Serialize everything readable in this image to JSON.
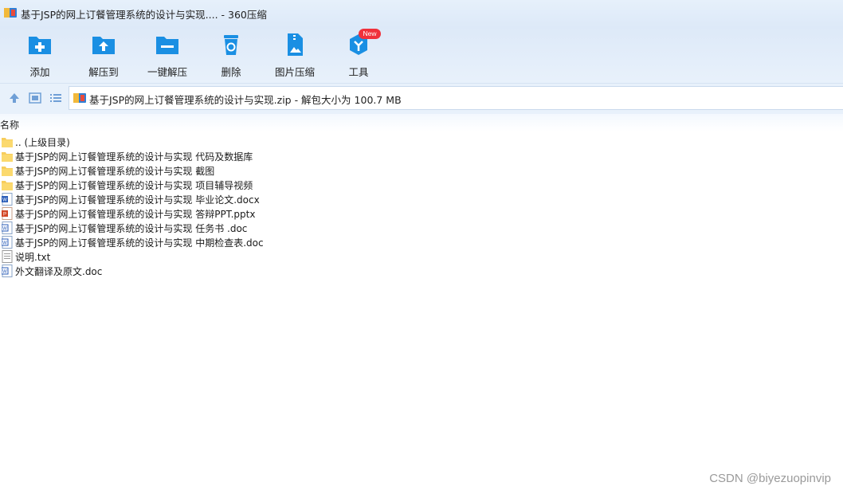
{
  "window": {
    "title": "基于JSP的网上订餐管理系统的设计与实现.... - 360压缩"
  },
  "toolbar": {
    "add_label": "添加",
    "extract_label": "解压到",
    "one_click_label": "一键解压",
    "delete_label": "删除",
    "image_compress_label": "图片压缩",
    "tools_label": "工具",
    "tools_badge": "New"
  },
  "address": {
    "path_text": "基于JSP的网上订餐管理系统的设计与实现.zip - 解包大小为 100.7 MB"
  },
  "list": {
    "column_name": "名称",
    "files": [
      {
        "name": ".. (上级目录)",
        "icon": "folder-icon"
      },
      {
        "name": "基于JSP的网上订餐管理系统的设计与实现 代码及数据库",
        "icon": "folder-icon"
      },
      {
        "name": "基于JSP的网上订餐管理系统的设计与实现 截图",
        "icon": "folder-icon"
      },
      {
        "name": "基于JSP的网上订餐管理系统的设计与实现 项目辅导视频",
        "icon": "folder-icon"
      },
      {
        "name": "基于JSP的网上订餐管理系统的设计与实现 毕业论文.docx",
        "icon": "word-docx-icon"
      },
      {
        "name": "基于JSP的网上订餐管理系统的设计与实现 答辩PPT.pptx",
        "icon": "powerpoint-icon"
      },
      {
        "name": "基于JSP的网上订餐管理系统的设计与实现 任务书 .doc",
        "icon": "word-doc-icon"
      },
      {
        "name": "基于JSP的网上订餐管理系统的设计与实现 中期检查表.doc",
        "icon": "word-doc-icon"
      },
      {
        "name": "说明.txt",
        "icon": "text-file-icon"
      },
      {
        "name": "外文翻译及原文.doc",
        "icon": "word-doc-icon"
      }
    ]
  },
  "watermark": "CSDN @biyezuopinvip",
  "colors": {
    "accent_blue": "#1a8fe3",
    "folder_yellow": "#f7cd5c",
    "badge_red": "#f0313b"
  }
}
